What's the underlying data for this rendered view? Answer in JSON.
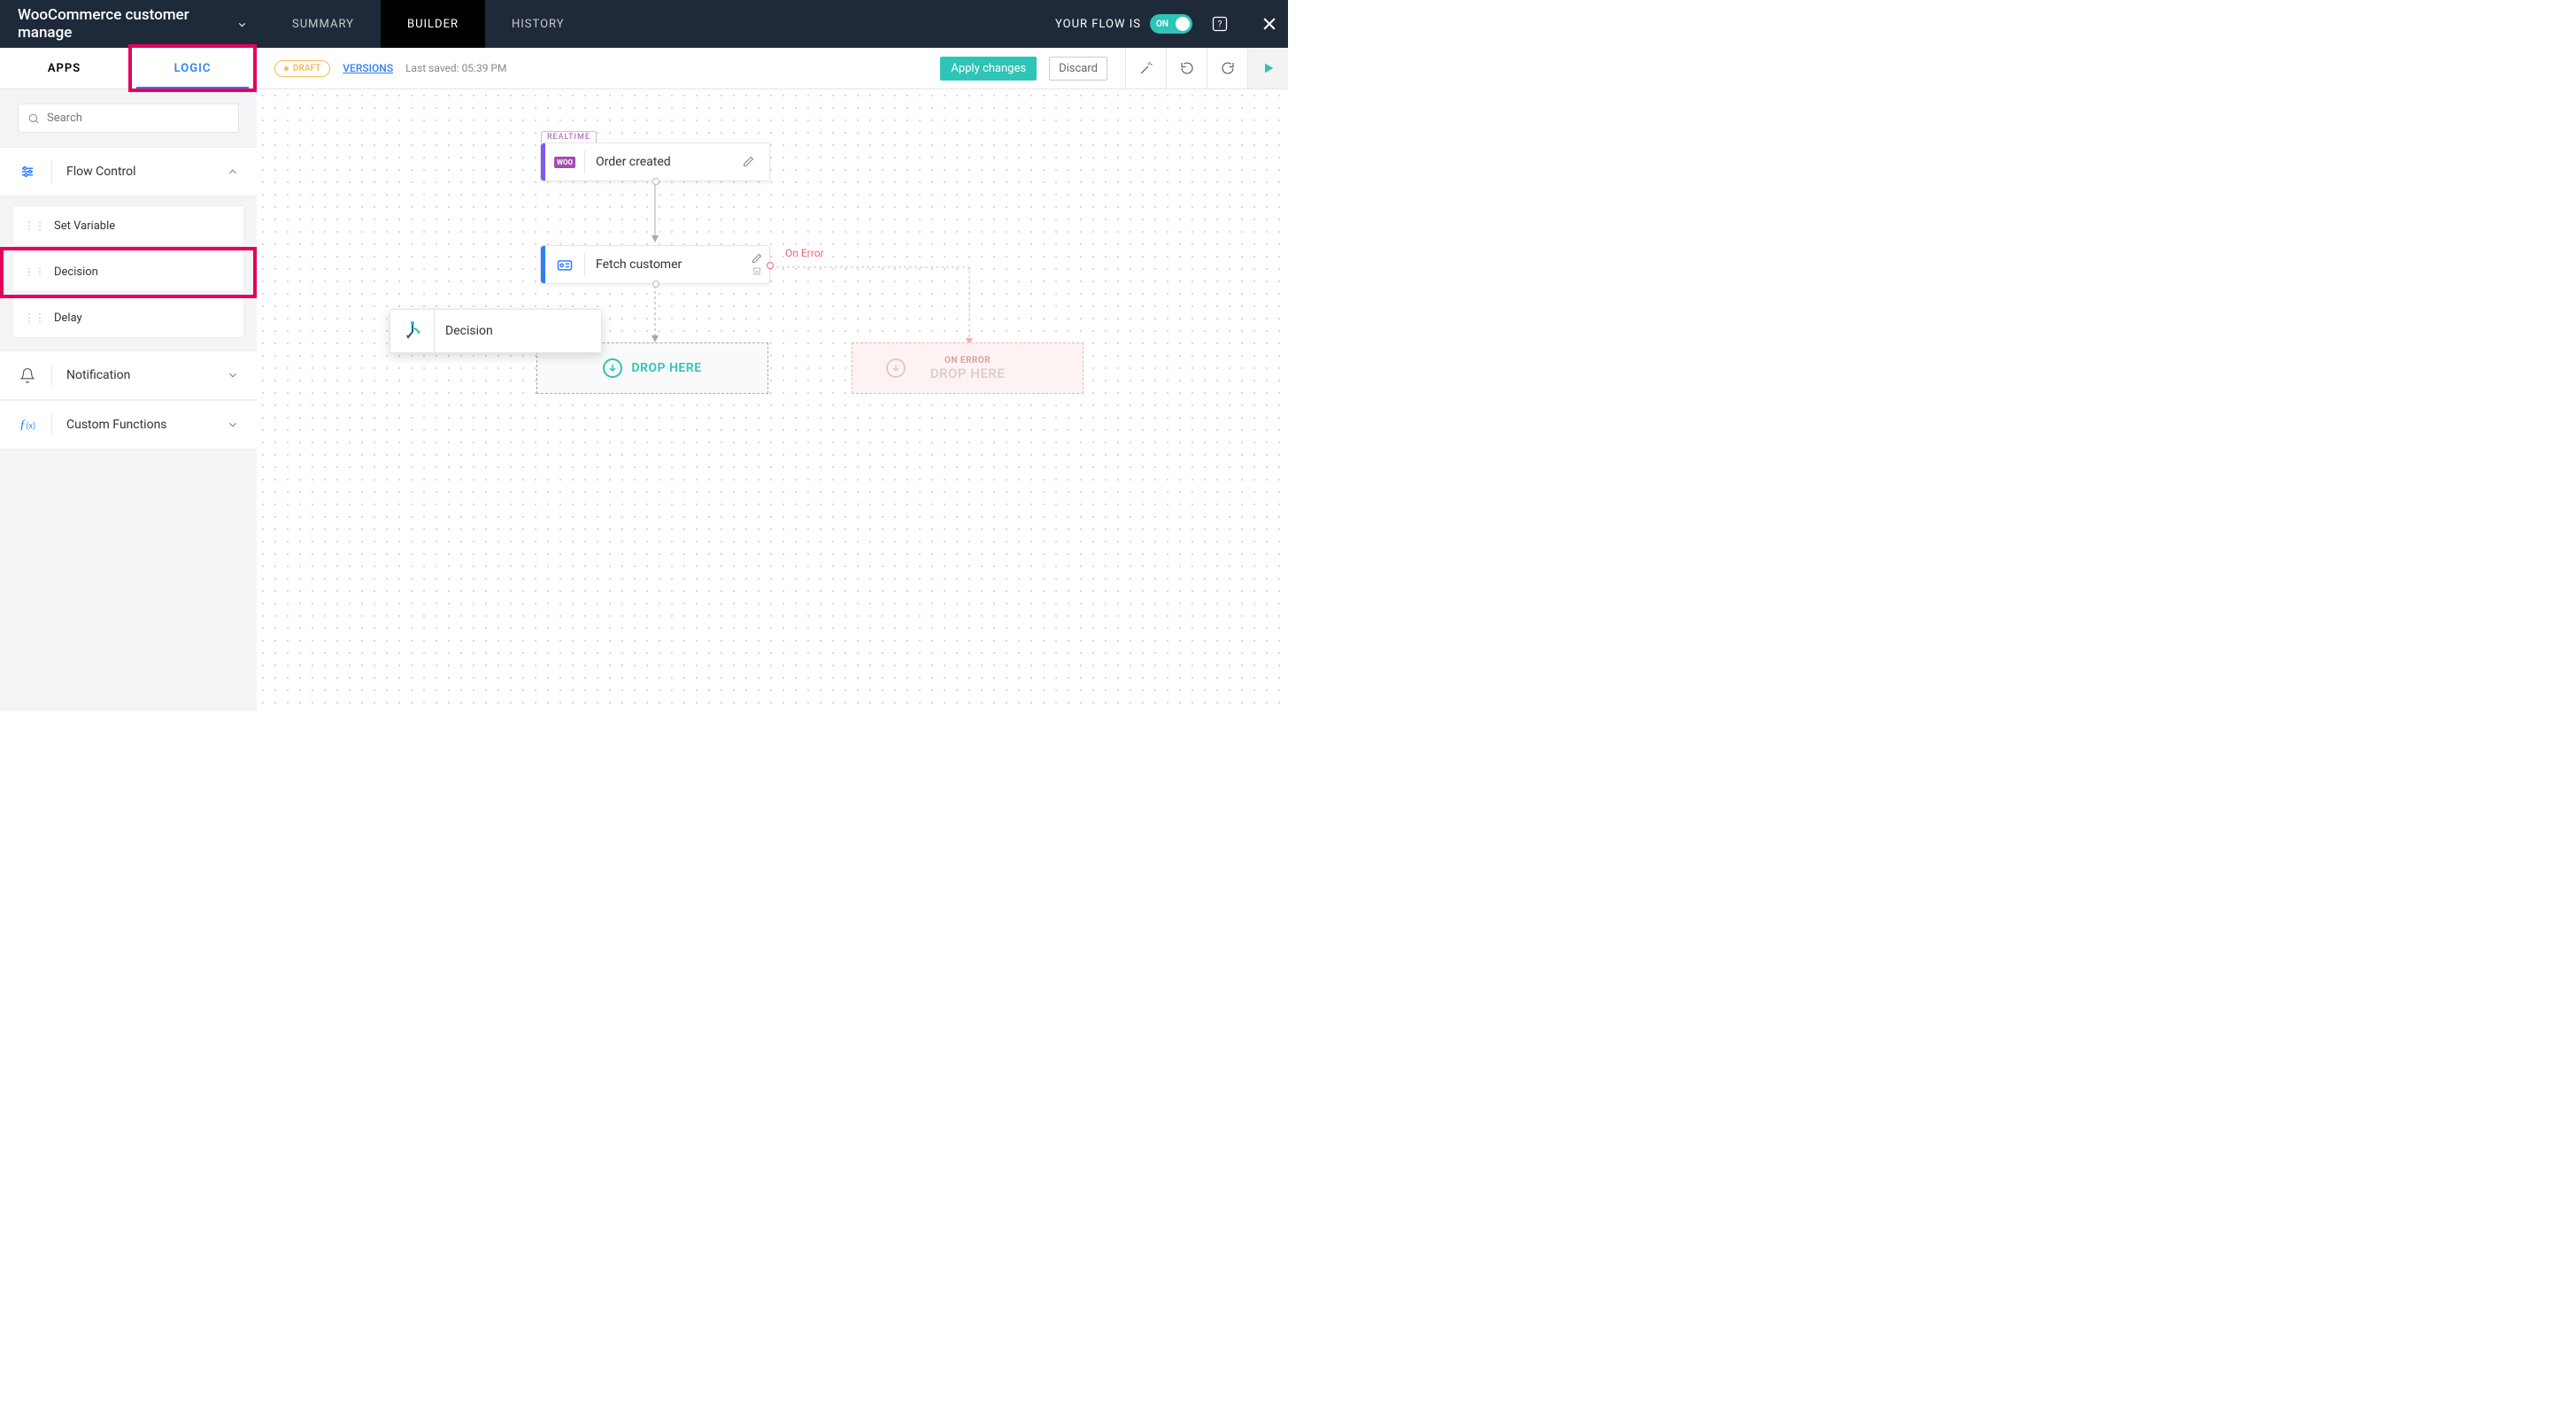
{
  "flow_name": "WooCommerce customer manage",
  "main_tabs": [
    "SUMMARY",
    "BUILDER",
    "HISTORY"
  ],
  "active_main_tab": "BUILDER",
  "flow_status_label": "YOUR FLOW IS",
  "toggle_state": "ON",
  "toolbar": {
    "draft_label": "DRAFT",
    "versions_label": "VERSIONS",
    "last_saved": "Last saved: 05:39 PM",
    "apply_label": "Apply changes",
    "discard_label": "Discard"
  },
  "sidebar": {
    "tabs": [
      "APPS",
      "LOGIC"
    ],
    "active_tab": "LOGIC",
    "search_placeholder": "Search",
    "categories": [
      {
        "name": "Flow Control",
        "icon": "flow-control",
        "expanded": true,
        "items": [
          "Set Variable",
          "Decision",
          "Delay"
        ]
      },
      {
        "name": "Notification",
        "icon": "bell",
        "expanded": false
      },
      {
        "name": "Custom Functions",
        "icon": "fx",
        "expanded": false
      }
    ]
  },
  "canvas": {
    "realtime_tag": "REALTIME",
    "node_order_created": "Order created",
    "node_fetch_customer": "Fetch customer",
    "drag_ghost": "Decision",
    "drop_here": "DROP HERE",
    "on_error_label": "On Error",
    "err_title": "ON ERROR",
    "err_drop": "DROP HERE"
  }
}
